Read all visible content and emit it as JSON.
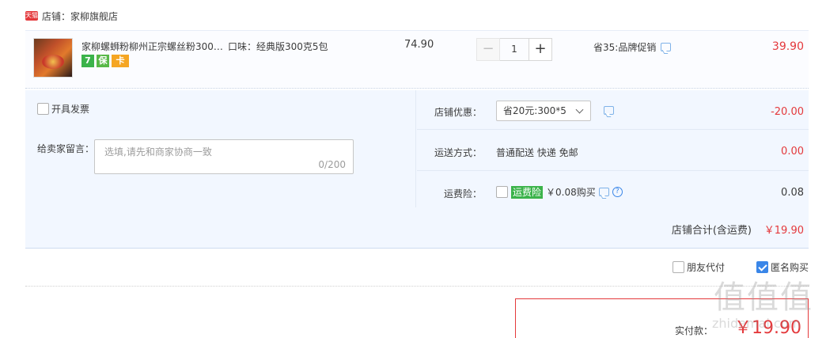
{
  "shop": {
    "logo_text": "天猫",
    "name": "店铺：家柳旗舰店"
  },
  "item": {
    "title": "家柳螺蛳粉柳州正宗螺丝粉300…",
    "sku": "口味：经典版300克5包",
    "unit_price": "74.90",
    "quantity": "1",
    "minus_label": "−",
    "plus_label": "+",
    "badges": [
      "7",
      "保",
      "卡"
    ],
    "promo": "省35:品牌促销",
    "total": "39.90"
  },
  "options": {
    "invoice_label": "开具发票",
    "message_label": "给卖家留言：",
    "message_placeholder": "选填,请先和商家协商一致",
    "message_count": "0/200",
    "discount": {
      "label": "店铺优惠：",
      "selected": "省20元:300*5",
      "value": "-20.00"
    },
    "shipping": {
      "label": "运送方式：",
      "method": "普通配送 快递 免邮",
      "value": "0.00"
    },
    "insurance": {
      "label": "运费险：",
      "tag": "运费险",
      "text": "￥0.08购买",
      "help": "?",
      "value": "0.08"
    },
    "shop_total": {
      "label": "店铺合计(含运费)",
      "value": "￥19.90"
    }
  },
  "bottom": {
    "friend_pay": "朋友代付",
    "anonymous": "匿名购买"
  },
  "payment": {
    "label": "实付款：",
    "value": "￥19.90"
  },
  "watermark": {
    "glyphs": "值值值",
    "sub": "zhidemai.com"
  },
  "colors": {
    "accent_red": "#e4393c",
    "option_bg": "#f2f7ff",
    "check_blue": "#3a86e8",
    "tag_green": "#3bb34a"
  }
}
